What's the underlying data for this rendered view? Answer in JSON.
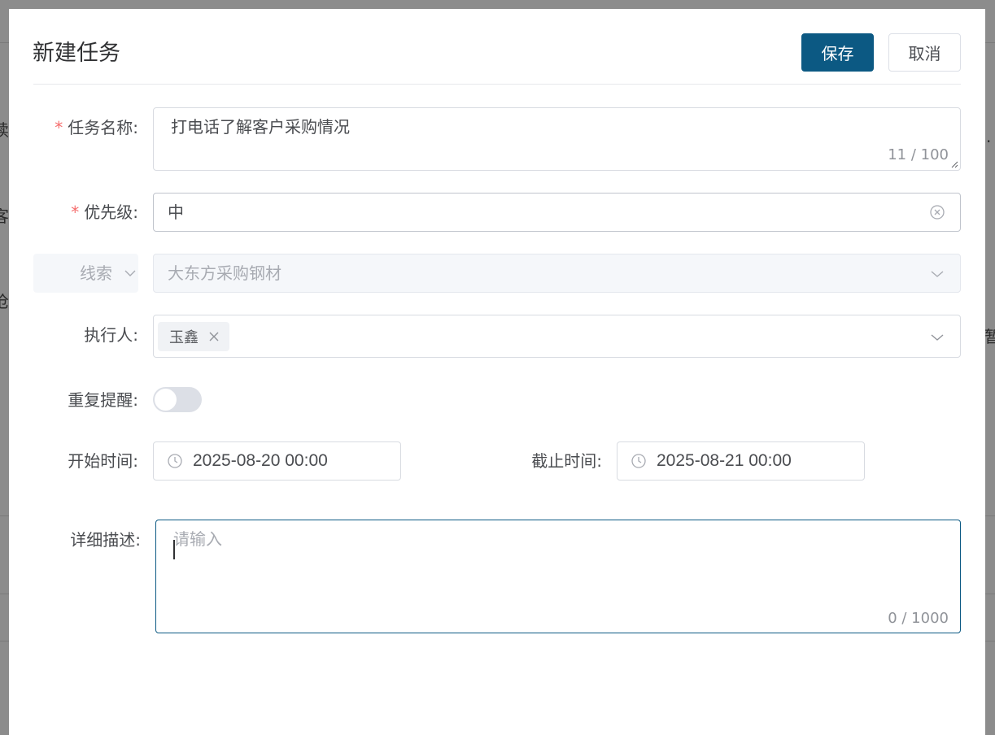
{
  "background": {
    "fragments": [
      "续",
      "客",
      "沧",
      "暂",
      "·"
    ]
  },
  "dialog": {
    "title": "新建任务",
    "save_label": "保存",
    "cancel_label": "取消"
  },
  "form": {
    "task_name": {
      "label": "任务名称:",
      "required_mark": "*",
      "value": "打电话了解客户采购情况",
      "counter": "11 / 100"
    },
    "priority": {
      "label": "优先级:",
      "required_mark": "*",
      "value": "中"
    },
    "related": {
      "type_label": "线索",
      "value": "大东方采购钢材"
    },
    "executor": {
      "label": "执行人:",
      "tags": [
        "玉鑫"
      ]
    },
    "repeat_reminder": {
      "label": "重复提醒:",
      "enabled": false
    },
    "start_time": {
      "label": "开始时间:",
      "value": "2025-08-20 00:00"
    },
    "end_time": {
      "label": "截止时间:",
      "value": "2025-08-21 00:00"
    },
    "description": {
      "label": "详细描述:",
      "placeholder": "请输入",
      "counter": "0 / 1000"
    }
  },
  "colors": {
    "primary": "#0c5983",
    "required": "#f56c6c",
    "overlay": "#8c8c8c"
  },
  "icons": {
    "clear": "circle-x-icon",
    "dropdown": "chevron-down-icon",
    "clock": "clock-icon",
    "tag_close": "close-icon"
  }
}
